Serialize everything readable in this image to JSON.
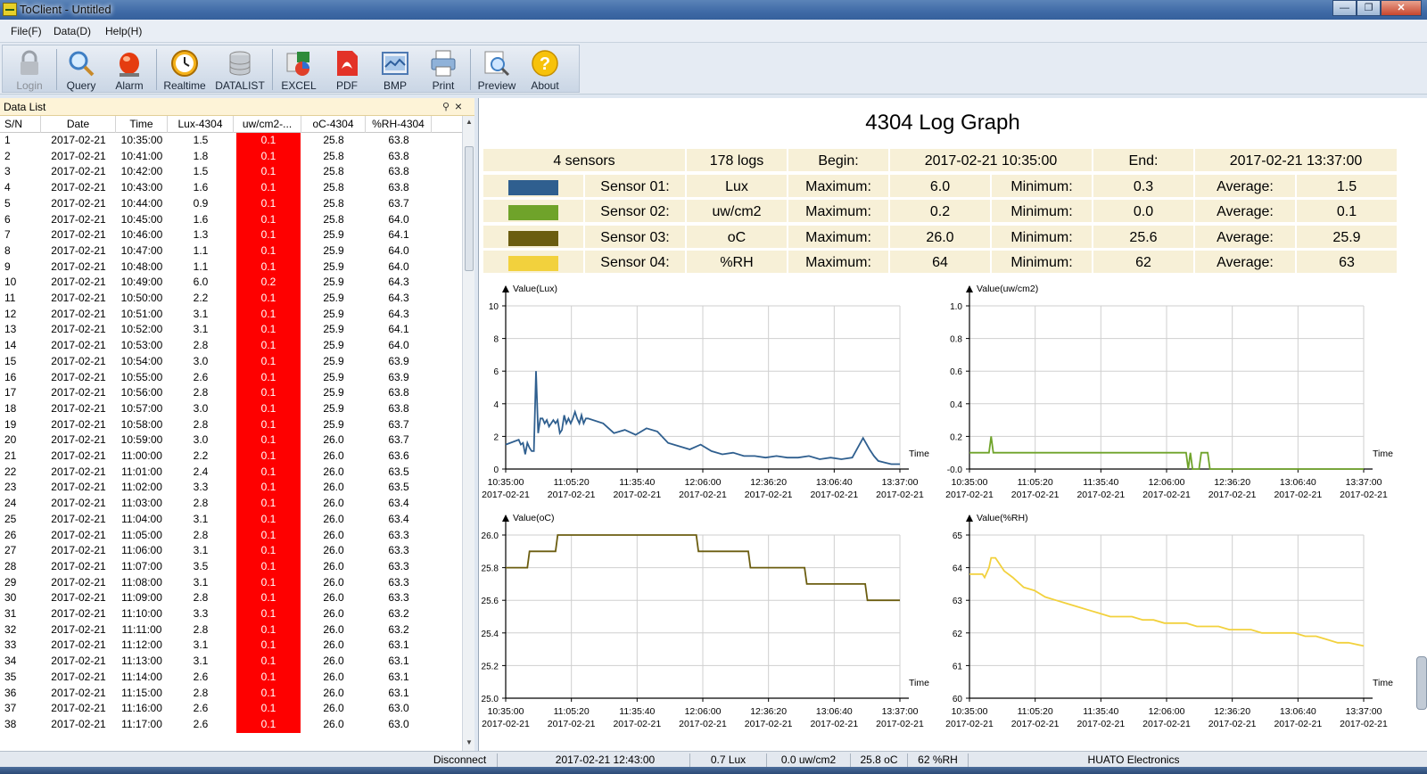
{
  "window": {
    "title": "ToClient - Untitled"
  },
  "menu": [
    "File(F)",
    "Data(D)",
    "Help(H)"
  ],
  "toolbar": [
    {
      "label": "Login",
      "icon": "lock-icon",
      "disabled": true
    },
    {
      "label": "Query",
      "icon": "magnifier-icon"
    },
    {
      "label": "Alarm",
      "icon": "alarm-light-icon"
    },
    {
      "label": "Realtime",
      "icon": "clock-icon"
    },
    {
      "label": "DATALIST",
      "icon": "database-icon"
    },
    {
      "label": "EXCEL",
      "icon": "excel-icon"
    },
    {
      "label": "PDF",
      "icon": "pdf-icon"
    },
    {
      "label": "BMP",
      "icon": "bmp-image-icon"
    },
    {
      "label": "Print",
      "icon": "printer-icon"
    },
    {
      "label": "Preview",
      "icon": "preview-icon"
    },
    {
      "label": "About",
      "icon": "question-icon"
    }
  ],
  "datalist": {
    "title": "Data List",
    "columns": [
      "S/N",
      "Date",
      "Time",
      "Lux-4304",
      "uw/cm2-...",
      "oC-4304",
      "%RH-4304"
    ],
    "rows": [
      [
        "1",
        "2017-02-21",
        "10:35:00",
        "1.5",
        "0.1",
        "25.8",
        "63.8"
      ],
      [
        "2",
        "2017-02-21",
        "10:41:00",
        "1.8",
        "0.1",
        "25.8",
        "63.8"
      ],
      [
        "3",
        "2017-02-21",
        "10:42:00",
        "1.5",
        "0.1",
        "25.8",
        "63.8"
      ],
      [
        "4",
        "2017-02-21",
        "10:43:00",
        "1.6",
        "0.1",
        "25.8",
        "63.8"
      ],
      [
        "5",
        "2017-02-21",
        "10:44:00",
        "0.9",
        "0.1",
        "25.8",
        "63.7"
      ],
      [
        "6",
        "2017-02-21",
        "10:45:00",
        "1.6",
        "0.1",
        "25.8",
        "64.0"
      ],
      [
        "7",
        "2017-02-21",
        "10:46:00",
        "1.3",
        "0.1",
        "25.9",
        "64.1"
      ],
      [
        "8",
        "2017-02-21",
        "10:47:00",
        "1.1",
        "0.1",
        "25.9",
        "64.0"
      ],
      [
        "9",
        "2017-02-21",
        "10:48:00",
        "1.1",
        "0.1",
        "25.9",
        "64.0"
      ],
      [
        "10",
        "2017-02-21",
        "10:49:00",
        "6.0",
        "0.2",
        "25.9",
        "64.3"
      ],
      [
        "11",
        "2017-02-21",
        "10:50:00",
        "2.2",
        "0.1",
        "25.9",
        "64.3"
      ],
      [
        "12",
        "2017-02-21",
        "10:51:00",
        "3.1",
        "0.1",
        "25.9",
        "64.3"
      ],
      [
        "13",
        "2017-02-21",
        "10:52:00",
        "3.1",
        "0.1",
        "25.9",
        "64.1"
      ],
      [
        "14",
        "2017-02-21",
        "10:53:00",
        "2.8",
        "0.1",
        "25.9",
        "64.0"
      ],
      [
        "15",
        "2017-02-21",
        "10:54:00",
        "3.0",
        "0.1",
        "25.9",
        "63.9"
      ],
      [
        "16",
        "2017-02-21",
        "10:55:00",
        "2.6",
        "0.1",
        "25.9",
        "63.9"
      ],
      [
        "17",
        "2017-02-21",
        "10:56:00",
        "2.8",
        "0.1",
        "25.9",
        "63.8"
      ],
      [
        "18",
        "2017-02-21",
        "10:57:00",
        "3.0",
        "0.1",
        "25.9",
        "63.8"
      ],
      [
        "19",
        "2017-02-21",
        "10:58:00",
        "2.8",
        "0.1",
        "25.9",
        "63.7"
      ],
      [
        "20",
        "2017-02-21",
        "10:59:00",
        "3.0",
        "0.1",
        "26.0",
        "63.7"
      ],
      [
        "21",
        "2017-02-21",
        "11:00:00",
        "2.2",
        "0.1",
        "26.0",
        "63.6"
      ],
      [
        "22",
        "2017-02-21",
        "11:01:00",
        "2.4",
        "0.1",
        "26.0",
        "63.5"
      ],
      [
        "23",
        "2017-02-21",
        "11:02:00",
        "3.3",
        "0.1",
        "26.0",
        "63.5"
      ],
      [
        "24",
        "2017-02-21",
        "11:03:00",
        "2.8",
        "0.1",
        "26.0",
        "63.4"
      ],
      [
        "25",
        "2017-02-21",
        "11:04:00",
        "3.1",
        "0.1",
        "26.0",
        "63.4"
      ],
      [
        "26",
        "2017-02-21",
        "11:05:00",
        "2.8",
        "0.1",
        "26.0",
        "63.3"
      ],
      [
        "27",
        "2017-02-21",
        "11:06:00",
        "3.1",
        "0.1",
        "26.0",
        "63.3"
      ],
      [
        "28",
        "2017-02-21",
        "11:07:00",
        "3.5",
        "0.1",
        "26.0",
        "63.3"
      ],
      [
        "29",
        "2017-02-21",
        "11:08:00",
        "3.1",
        "0.1",
        "26.0",
        "63.3"
      ],
      [
        "30",
        "2017-02-21",
        "11:09:00",
        "2.8",
        "0.1",
        "26.0",
        "63.3"
      ],
      [
        "31",
        "2017-02-21",
        "11:10:00",
        "3.3",
        "0.1",
        "26.0",
        "63.2"
      ],
      [
        "32",
        "2017-02-21",
        "11:11:00",
        "2.8",
        "0.1",
        "26.0",
        "63.2"
      ],
      [
        "33",
        "2017-02-21",
        "11:12:00",
        "3.1",
        "0.1",
        "26.0",
        "63.1"
      ],
      [
        "34",
        "2017-02-21",
        "11:13:00",
        "3.1",
        "0.1",
        "26.0",
        "63.1"
      ],
      [
        "35",
        "2017-02-21",
        "11:14:00",
        "2.6",
        "0.1",
        "26.0",
        "63.1"
      ],
      [
        "36",
        "2017-02-21",
        "11:15:00",
        "2.8",
        "0.1",
        "26.0",
        "63.1"
      ],
      [
        "37",
        "2017-02-21",
        "11:16:00",
        "2.6",
        "0.1",
        "26.0",
        "63.0"
      ],
      [
        "38",
        "2017-02-21",
        "11:17:00",
        "2.6",
        "0.1",
        "26.0",
        "63.0"
      ]
    ],
    "alarm_color": "#fe0000"
  },
  "graph": {
    "title": "4304 Log Graph",
    "summary": {
      "sensors": "4 sensors",
      "logs": "178 logs",
      "begin_label": "Begin:",
      "begin": "2017-02-21 10:35:00",
      "end_label": "End:",
      "end": "2017-02-21 13:37:00",
      "sensor_rows": [
        {
          "name": "Sensor 01:",
          "unit": "Lux",
          "max": "6.0",
          "min": "0.3",
          "avg": "1.5",
          "color": "#2f5f8f"
        },
        {
          "name": "Sensor 02:",
          "unit": "uw/cm2",
          "max": "0.2",
          "min": "0.0",
          "avg": "0.1",
          "color": "#6fa32a"
        },
        {
          "name": "Sensor 03:",
          "unit": "oC",
          "max": "26.0",
          "min": "25.6",
          "avg": "25.9",
          "color": "#6b5d10"
        },
        {
          "name": "Sensor 04:",
          "unit": "%RH",
          "max": "64",
          "min": "62",
          "avg": "63",
          "color": "#f2d13d"
        }
      ],
      "max_label": "Maximum:",
      "min_label": "Minimum:",
      "avg_label": "Average:"
    }
  },
  "chart_data": [
    {
      "type": "line",
      "ylabel": "Value(Lux)",
      "xlabel": "Time",
      "ylim": [
        0,
        10
      ],
      "yticks": [
        "0",
        "2",
        "4",
        "6",
        "8",
        "10"
      ],
      "xticks": [
        "10:35:00",
        "11:05:20",
        "11:35:40",
        "12:06:00",
        "12:36:20",
        "13:06:40",
        "13:37:00"
      ],
      "xdate": "2017-02-21",
      "color": "#2f5f8f",
      "x_minutes": [
        0,
        6,
        7,
        8,
        9,
        10,
        11,
        12,
        13,
        14,
        15,
        16,
        17,
        18,
        19,
        20,
        21,
        22,
        23,
        24,
        25,
        26,
        27,
        28,
        29,
        30,
        31,
        32,
        33,
        34,
        35,
        36,
        37,
        38,
        45,
        50,
        55,
        60,
        65,
        70,
        75,
        80,
        85,
        90,
        95,
        100,
        105,
        110,
        115,
        120,
        125,
        130,
        135,
        140,
        145,
        150,
        155,
        160,
        165,
        168,
        170,
        172,
        175,
        178,
        182
      ],
      "values": [
        1.5,
        1.8,
        1.5,
        1.6,
        0.9,
        1.6,
        1.3,
        1.1,
        1.1,
        6.0,
        2.2,
        3.1,
        3.1,
        2.8,
        3.0,
        2.6,
        2.8,
        3.0,
        2.8,
        3.0,
        2.2,
        2.4,
        3.3,
        2.8,
        3.1,
        2.8,
        3.1,
        3.5,
        3.1,
        2.8,
        3.3,
        2.8,
        3.1,
        3.1,
        2.8,
        2.2,
        2.4,
        2.1,
        2.5,
        2.3,
        1.6,
        1.4,
        1.2,
        1.5,
        1.1,
        0.9,
        1.0,
        0.8,
        0.8,
        0.7,
        0.8,
        0.7,
        0.7,
        0.8,
        0.6,
        0.7,
        0.6,
        0.7,
        1.9,
        1.2,
        0.8,
        0.5,
        0.4,
        0.3,
        0.3
      ]
    },
    {
      "type": "line",
      "ylabel": "Value(uw/cm2)",
      "xlabel": "Time",
      "ylim": [
        0,
        1.0
      ],
      "yticks": [
        "-0.0",
        "0.2",
        "0.4",
        "0.6",
        "0.8",
        "1.0"
      ],
      "xticks": [
        "10:35:00",
        "11:05:20",
        "11:35:40",
        "12:06:00",
        "12:36:20",
        "13:06:40",
        "13:37:00"
      ],
      "xdate": "2017-02-21",
      "color": "#6fa32a",
      "x_minutes": [
        0,
        9,
        10,
        11,
        100,
        101,
        102,
        103,
        104,
        106,
        107,
        108,
        110,
        111,
        112,
        182
      ],
      "values": [
        0.1,
        0.1,
        0.2,
        0.1,
        0.1,
        0.0,
        0.1,
        0.0,
        0.0,
        0.0,
        0.1,
        0.1,
        0.1,
        0.0,
        0.0,
        0.0
      ]
    },
    {
      "type": "line",
      "ylabel": "Value(oC)",
      "xlabel": "Time",
      "ylim": [
        25.0,
        26.0
      ],
      "yticks": [
        "25.0",
        "25.2",
        "25.4",
        "25.6",
        "25.8",
        "26.0"
      ],
      "xticks": [
        "10:35:00",
        "11:05:20",
        "11:35:40",
        "12:06:00",
        "12:36:20",
        "13:06:40",
        "13:37:00"
      ],
      "xdate": "2017-02-21",
      "color": "#6b5d10",
      "x_minutes": [
        0,
        10,
        11,
        23,
        24,
        88,
        89,
        112,
        113,
        138,
        139,
        166,
        167,
        182
      ],
      "values": [
        25.8,
        25.8,
        25.9,
        25.9,
        26.0,
        26.0,
        25.9,
        25.9,
        25.8,
        25.8,
        25.7,
        25.7,
        25.6,
        25.6
      ]
    },
    {
      "type": "line",
      "ylabel": "Value(%RH)",
      "xlabel": "Time",
      "ylim": [
        60,
        65
      ],
      "yticks": [
        "60",
        "61",
        "62",
        "63",
        "64",
        "65"
      ],
      "xticks": [
        "10:35:00",
        "11:05:20",
        "11:35:40",
        "12:06:00",
        "12:36:20",
        "13:06:40",
        "13:37:00"
      ],
      "xdate": "2017-02-21",
      "color": "#f2d13d",
      "x_minutes": [
        0,
        6,
        7,
        9,
        10,
        12,
        14,
        16,
        20,
        25,
        30,
        35,
        40,
        45,
        50,
        55,
        60,
        65,
        70,
        75,
        80,
        85,
        90,
        95,
        100,
        105,
        110,
        115,
        120,
        125,
        130,
        135,
        140,
        145,
        150,
        155,
        160,
        165,
        170,
        175,
        182
      ],
      "values": [
        63.8,
        63.8,
        63.7,
        64.0,
        64.3,
        64.3,
        64.1,
        63.9,
        63.7,
        63.4,
        63.3,
        63.1,
        63.0,
        62.9,
        62.8,
        62.7,
        62.6,
        62.5,
        62.5,
        62.5,
        62.4,
        62.4,
        62.3,
        62.3,
        62.3,
        62.2,
        62.2,
        62.2,
        62.1,
        62.1,
        62.1,
        62.0,
        62.0,
        62.0,
        62.0,
        61.9,
        61.9,
        61.8,
        61.7,
        61.7,
        61.6
      ]
    }
  ],
  "status": {
    "connection": "Disconnect",
    "time": "2017-02-21 12:43:00",
    "lux": "0.7 Lux",
    "uv": "0.0 uw/cm2",
    "temp": "25.8 oC",
    "rh": "62 %RH",
    "company": "HUATO Electronics"
  }
}
